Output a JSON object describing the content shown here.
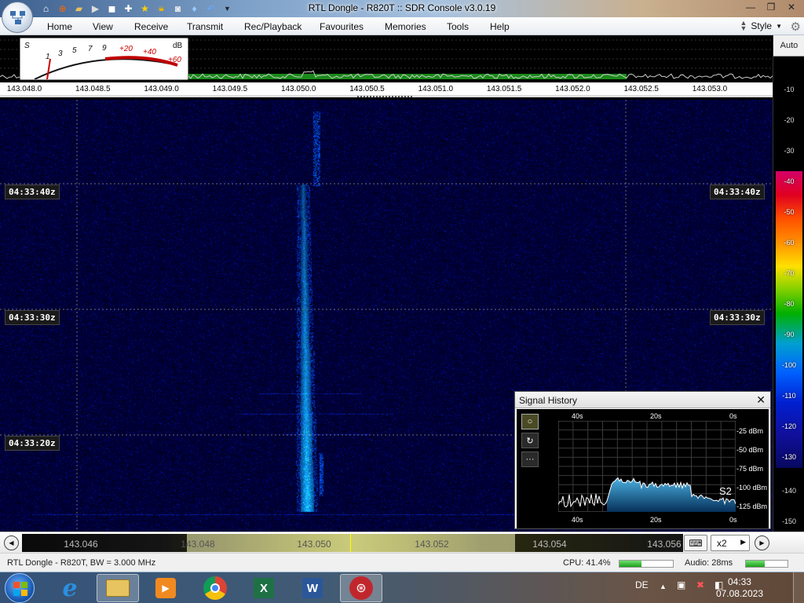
{
  "window": {
    "title": "RTL Dongle - R820T :: SDR Console v3.0.19"
  },
  "menu": {
    "items": [
      "Home",
      "View",
      "Receive",
      "Transmit",
      "Rec/Playback",
      "Favourites",
      "Memories",
      "Tools",
      "Help"
    ],
    "style_label": "Style"
  },
  "spectrum": {
    "smeter_labels": [
      "S",
      "1",
      "3",
      "5",
      "7",
      "9",
      "+20",
      "+40",
      "+60",
      "dB"
    ],
    "freq_labels": [
      "143.048.0",
      "143.048.5",
      "143.049.0",
      "143.049.5",
      "143.050.0",
      "143.050.5",
      "143.051.0",
      "143.051.5",
      "143.052.0",
      "143.052.5",
      "143.053.0"
    ]
  },
  "waterfall": {
    "timestamps": [
      "04:33:40z",
      "04:33:30z",
      "04:33:20z"
    ]
  },
  "scale": {
    "auto_label": "Auto",
    "upper_labels": [
      "-10",
      "-20",
      "-30"
    ],
    "bar_labels": [
      "-40",
      "-50",
      "-60",
      "-70",
      "-80",
      "-90",
      "-100",
      "-110",
      "-120",
      "-130"
    ],
    "lower_labels": [
      "-140",
      "-150"
    ]
  },
  "signal_history": {
    "title": "Signal History",
    "close_label": "✕",
    "top_axis": [
      "40s",
      "20s",
      "0s"
    ],
    "bottom_axis": [
      "40s",
      "20s",
      "0s"
    ],
    "y_labels": [
      "-25 dBm",
      "-50 dBm",
      "-75 dBm",
      "-100 dBm",
      "-125 dBm"
    ],
    "s_reading": "S2",
    "buttons": [
      "○",
      "↻",
      "···"
    ]
  },
  "scroller": {
    "labels": [
      "143.046",
      "143.048",
      "143.050",
      "143.052",
      "143.054",
      "143.056"
    ],
    "zoom_label": "x2"
  },
  "status": {
    "device": "RTL Dongle - R820T, BW = 3.000 MHz",
    "cpu": "CPU: 41.4%",
    "cpu_level": 0.41,
    "audio": "Audio: 28ms",
    "audio_level": 0.45
  },
  "taskbar": {
    "apps": [
      "internet-explorer",
      "file-explorer",
      "media-player",
      "chrome",
      "excel",
      "word",
      "sdr-console"
    ],
    "language": "DE",
    "time": "04:33",
    "date": "07.08.2023"
  },
  "colors": {
    "accent": "#2f5f9e",
    "waterfall_bg": "#000020",
    "signal_cyan": "#40d0ff"
  }
}
